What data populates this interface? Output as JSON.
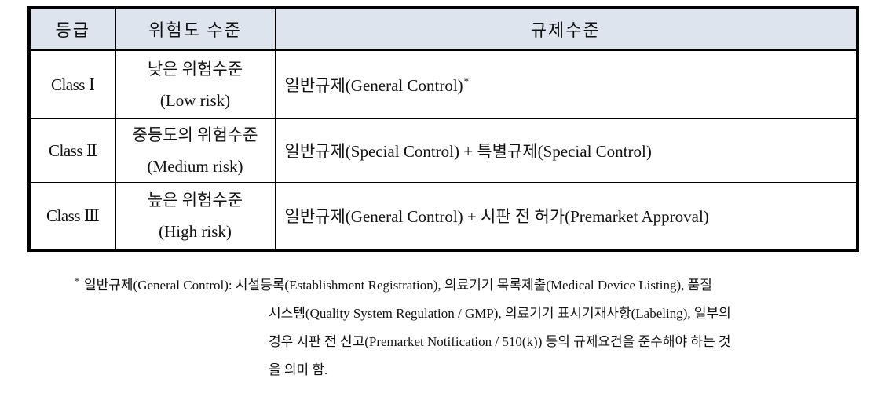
{
  "table": {
    "headers": [
      "등급",
      "위험도 수준",
      "규제수준"
    ],
    "rows": [
      {
        "class": "Class  Ⅰ",
        "risk_ko": "낮은 위험수준",
        "risk_en": "(Low risk)",
        "regulation": "일반규제(General Control)",
        "footnote_mark": "*"
      },
      {
        "class": "Class  Ⅱ",
        "risk_ko": "중등도의 위험수준",
        "risk_en": "(Medium risk)",
        "regulation": "일반규제(Special Control) + 특별규제(Special Control)",
        "footnote_mark": ""
      },
      {
        "class": "Class  Ⅲ",
        "risk_ko": "높은 위험수준",
        "risk_en": "(High risk)",
        "regulation": "일반규제(General Control) + 시판 전 허가(Premarket Approval)",
        "footnote_mark": ""
      }
    ]
  },
  "footnote": {
    "mark": "*",
    "term": "일반규제(General Control):",
    "line1": "시설등록(Establishment Registration), 의료기기 목록제출(Medical Device Listing), 품질",
    "line2": "시스템(Quality System Regulation / GMP), 의료기기 표시기재사항(Labeling), 일부의",
    "line3": "경우 시판 전 신고(Premarket Notification / 510(k)) 등의 규제요건을 준수해야 하는 것",
    "line4": "을 의미 함."
  },
  "colors": {
    "header_bg": "#dde4ee",
    "border": "#000000",
    "text": "#111111"
  }
}
